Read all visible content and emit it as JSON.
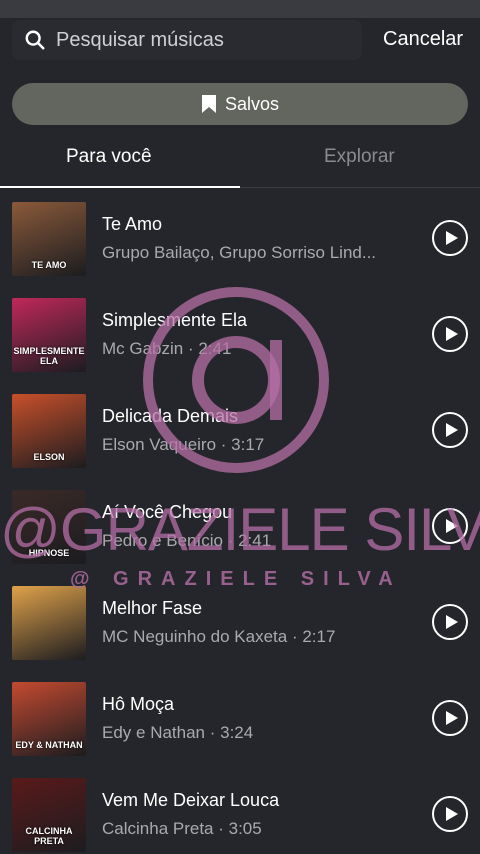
{
  "search": {
    "placeholder": "Pesquisar músicas",
    "cancel_label": "Cancelar"
  },
  "saved_button": {
    "label": "Salvos",
    "icon": "bookmark-icon"
  },
  "tabs": [
    {
      "label": "Para você",
      "active": true
    },
    {
      "label": "Explorar",
      "active": false
    }
  ],
  "songs": [
    {
      "title": "Te Amo",
      "subtitle": "Grupo Bailaço, Grupo Sorriso Lind...",
      "cover_text": "TE AMO",
      "cover_color": "#8a5a3a"
    },
    {
      "title": "Simplesmente Ela",
      "subtitle": "Mc Gabzin · 2:41",
      "cover_text": "SIMPLESMENTE ELA",
      "cover_color": "#c0285a"
    },
    {
      "title": "Delicada Demais",
      "subtitle": "Elson Vaqueiro · 3:17",
      "cover_text": "ELSON",
      "cover_color": "#c8502a"
    },
    {
      "title": "Aí Você Chegou",
      "subtitle": "Pedro e Benício · 2:41",
      "cover_text": "HIPNOSE",
      "cover_color": "#3a2a28"
    },
    {
      "title": "Melhor Fase",
      "subtitle": "MC Neguinho do Kaxeta · 2:17",
      "cover_text": "",
      "cover_color": "#e0a24a"
    },
    {
      "title": "Hô Moça",
      "subtitle": "Edy e Nathan · 3:24",
      "cover_text": "EDY & NATHAN",
      "cover_color": "#c44a30"
    },
    {
      "title": "Vem Me Deixar Louca",
      "subtitle": "Calcinha Preta · 3:05",
      "cover_text": "CALCINHA PRETA",
      "cover_color": "#5a1a1a"
    }
  ],
  "watermark": {
    "symbol": "@",
    "name": "@GRAZIELE SILVA",
    "sub": "@ GRAZIELE SILVA",
    "color": "#b56fa6"
  },
  "colors": {
    "background": "#25262b",
    "saved_pill": "#62665f",
    "muted_text": "#a9aaae"
  }
}
